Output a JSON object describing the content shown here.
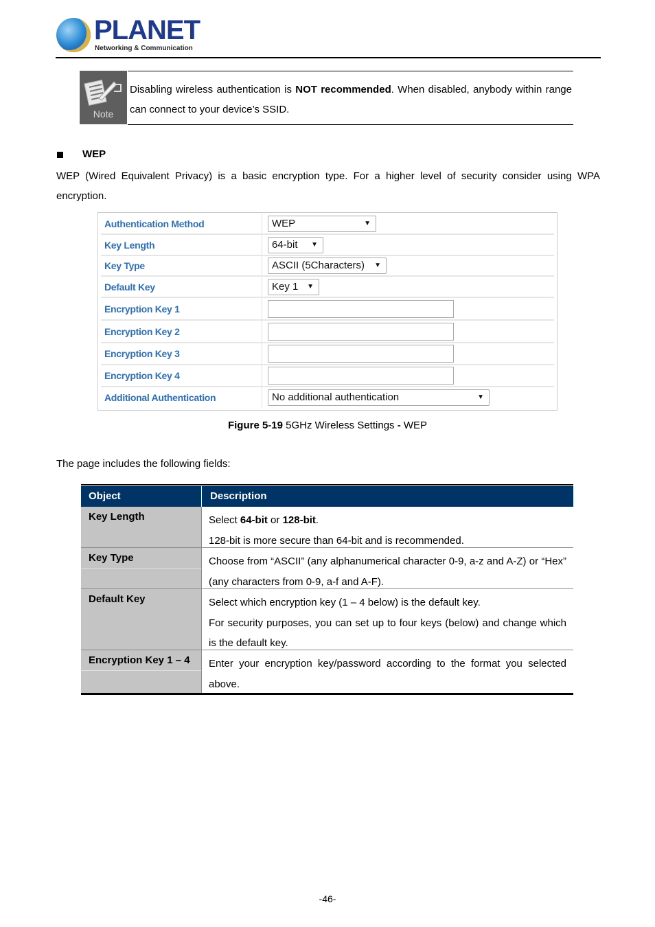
{
  "header": {
    "logo_word": "PLANET",
    "logo_tagline": "Networking & Communication"
  },
  "note": {
    "icon_label": "Note",
    "text_before": "Disabling wireless authentication is ",
    "text_bold": "NOT recommended",
    "text_after": ". When disabled, anybody within range can connect to your device’s SSID."
  },
  "section": {
    "title": "WEP",
    "intro": "WEP (Wired Equivalent Privacy) is a basic encryption type. For a higher level of security consider using WPA encryption."
  },
  "panel": {
    "rows": [
      {
        "label": "Authentication Method",
        "type": "select",
        "value": "WEP"
      },
      {
        "label": "Key Length",
        "type": "select",
        "value": "64-bit"
      },
      {
        "label": "Key Type",
        "type": "select",
        "value": "ASCII (5Characters)"
      },
      {
        "label": "Default Key",
        "type": "select",
        "value": "Key 1"
      },
      {
        "label": "Encryption Key 1",
        "type": "input",
        "value": ""
      },
      {
        "label": "Encryption Key 2",
        "type": "input",
        "value": ""
      },
      {
        "label": "Encryption Key 3",
        "type": "input",
        "value": ""
      },
      {
        "label": "Encryption Key 4",
        "type": "input",
        "value": ""
      },
      {
        "label": "Additional Authentication",
        "type": "select",
        "value": "No additional authentication"
      }
    ],
    "dropdown_arrow": "▼"
  },
  "caption": {
    "bold": "Figure 5-19",
    "text": " 5GHz Wireless Settings ",
    "dash": "-",
    "tail": " WEP"
  },
  "fields_intro": "The page includes the following fields:",
  "table": {
    "headers": [
      "Object",
      "Description"
    ],
    "rows": [
      {
        "object": "Key Length",
        "lines": [
          {
            "parts": [
              {
                "t": "Select ",
                "b": false
              },
              {
                "t": "64-bit",
                "b": true
              },
              {
                "t": " or ",
                "b": false
              },
              {
                "t": "128-bit",
                "b": true
              },
              {
                "t": ".",
                "b": false
              }
            ]
          },
          {
            "parts": [
              {
                "t": "128-bit is more secure than 64-bit and is recommended.",
                "b": false
              }
            ]
          }
        ]
      },
      {
        "object": "Key Type",
        "lines": [
          {
            "parts": [
              {
                "t": "Choose from “ASCII” (any alphanumerical character 0-9, a-z and A-Z) or “Hex” (any characters from 0-9, a-f and A-F).",
                "b": false
              }
            ]
          }
        ]
      },
      {
        "object": "Default Key",
        "lines": [
          {
            "parts": [
              {
                "t": "Select which encryption key (1 – 4 below) is the default key.",
                "b": false
              }
            ]
          },
          {
            "parts": [
              {
                "t": "For security purposes, you can set up to four keys (below) and change which is the default key.",
                "b": false
              }
            ]
          }
        ]
      },
      {
        "object": "Encryption Key 1 – 4",
        "lines": [
          {
            "parts": [
              {
                "t": "Enter your encryption key/password according to the format you selected above.",
                "b": false
              }
            ]
          }
        ]
      }
    ]
  },
  "page_number": "-46-"
}
